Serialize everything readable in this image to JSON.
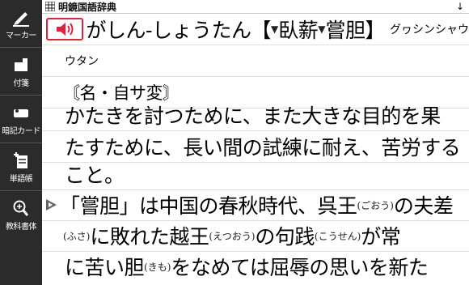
{
  "sidebar": {
    "items": [
      {
        "label": "マーカー",
        "icon": "marker-pen-icon"
      },
      {
        "label": "付箋",
        "icon": "sticky-note-icon"
      },
      {
        "label": "暗記カード",
        "icon": "memory-card-icon"
      },
      {
        "label": "単語帳",
        "icon": "wordbook-add-icon"
      },
      {
        "label": "教科書体",
        "icon": "magnify-font-icon"
      }
    ]
  },
  "header": {
    "title": "明鏡国語辞典",
    "scroll_indicator": "↓"
  },
  "entry": {
    "headword": "がしん-しょうたん【",
    "kanji_marked_1": "▼",
    "kanji_1": "臥薪",
    "kanji_marked_2": "▼",
    "kanji_2": "嘗胆",
    "headword_end": "】",
    "historical_kana": "グヮシンシャウ",
    "reading_note": "ウタン",
    "pos": "〘名・自サ変〙",
    "definition_line1": "かたきを討つために、また大きな目的を果",
    "definition_line2": "たすために、長い間の試練に耐え、苦労する",
    "definition_line3": "こと。",
    "etymology": {
      "line1_a": "「嘗胆」は中国の春秋時代、呉王",
      "line1_ruby": "(ごおう)",
      "line1_b": "の夫差",
      "line2_ruby1": "(ふさ)",
      "line2_a": "に敗れた越王",
      "line2_ruby2": "(えつおう)",
      "line2_b": "の句践",
      "line2_ruby3": "(こうせん)",
      "line2_c": "が常",
      "line3_a": "に苦い胆",
      "line3_ruby": "(きも)",
      "line3_b": "をなめては屈辱の思いを新た"
    }
  },
  "colors": {
    "sidebar_bg": "#2b2b2b",
    "speaker_accent": "#d8263c"
  }
}
